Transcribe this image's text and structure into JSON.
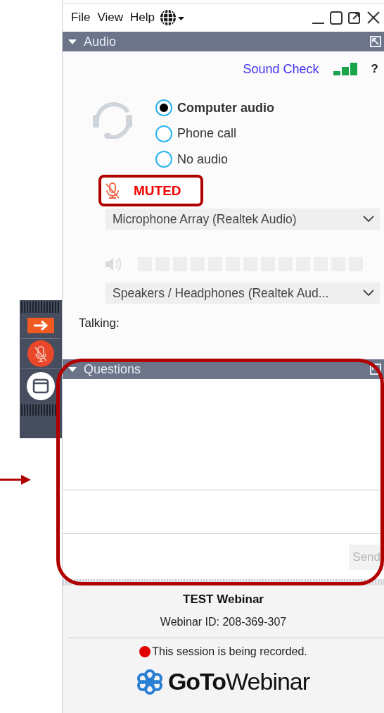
{
  "menu": [
    {
      "label": "File"
    },
    {
      "label": "View"
    },
    {
      "label": "Help"
    }
  ],
  "audio": {
    "title": "Audio",
    "sound_check": "Sound Check",
    "help": "?",
    "options": [
      {
        "label": "Computer audio",
        "selected": true
      },
      {
        "label": "Phone call",
        "selected": false
      },
      {
        "label": "No audio",
        "selected": false
      }
    ],
    "muted_label": "MUTED",
    "microphone": "Microphone Array (Realtek Audio)",
    "speaker_meter": {
      "level": 0
    },
    "speaker": "Speakers / Headphones (Realtek Aud...",
    "talking_label": "Talking:"
  },
  "questions": {
    "title": "Questions",
    "send": {
      "label": "Send",
      "disabled": true
    }
  },
  "footer": {
    "webinar_title": "TEST Webinar",
    "webinar_id": "Webinar ID: 208-369-307",
    "recording_notice": "This session is being recorded.",
    "logo": "**GoTo**Webinar"
  }
}
